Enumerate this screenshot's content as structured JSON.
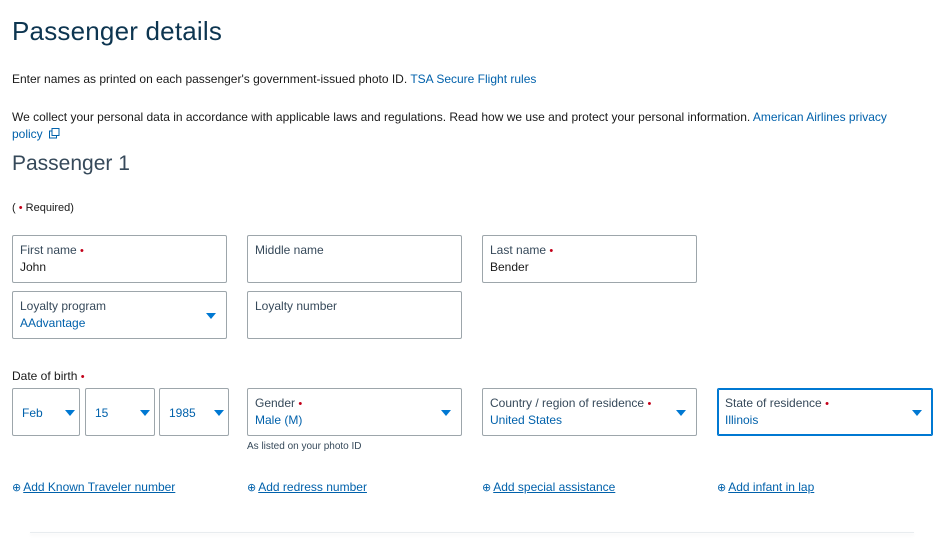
{
  "page": {
    "title": "Passenger details",
    "intro_text": "Enter names as printed on each passenger's government-issued photo ID. ",
    "tsa_link": "TSA Secure Flight rules",
    "privacy_text": "We collect your personal data in accordance with applicable laws and regulations. Read how we use and protect your personal information. ",
    "privacy_link": "American Airlines privacy policy",
    "privacy_icon": "external-link-icon"
  },
  "passenger": {
    "heading": "Passenger 1",
    "required_open": "(",
    "required_dot": "•",
    "required_label": " Required)",
    "first_name": {
      "label": "First name",
      "value": "John",
      "required": "•"
    },
    "middle_name": {
      "label": "Middle name",
      "value": ""
    },
    "last_name": {
      "label": "Last name",
      "value": "Bender",
      "required": "•"
    },
    "loyalty_program": {
      "label": "Loyalty program",
      "value": "AAdvantage"
    },
    "loyalty_number": {
      "label": "Loyalty number",
      "value": ""
    },
    "dob": {
      "label": "Date of birth",
      "required": "•",
      "month": "Feb",
      "day": "15",
      "year": "1985"
    },
    "gender": {
      "label": "Gender",
      "value": "Male (M)",
      "required": "•",
      "hint": "As listed on your photo ID"
    },
    "country": {
      "label": "Country / region of residence",
      "value": "United States",
      "required": "•"
    },
    "state": {
      "label": "State of residence",
      "value": "Illinois",
      "required": "•"
    }
  },
  "add_links": {
    "plus_glyph": "⊕",
    "known_traveler": "Add Known Traveler number",
    "redress": "Add redress number",
    "special_assistance": "Add special assistance",
    "infant": "Add infant in lap"
  },
  "colors": {
    "accent": "#0078d2",
    "link": "#0061ab",
    "required": "#c30019",
    "heading": "#0d3550"
  }
}
